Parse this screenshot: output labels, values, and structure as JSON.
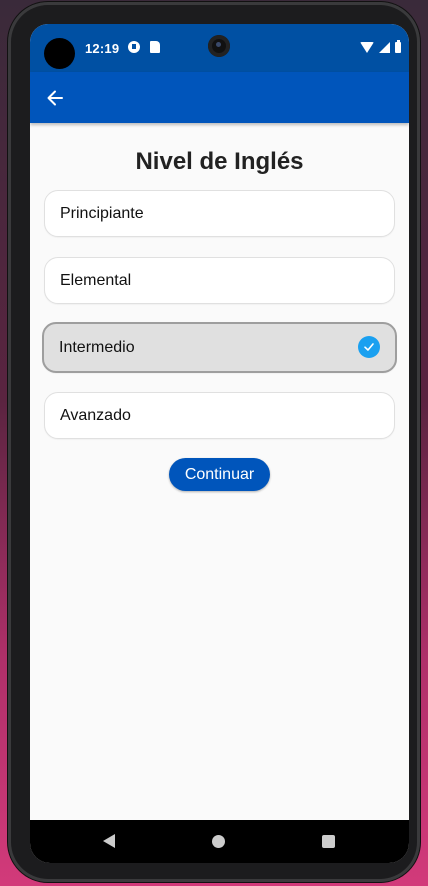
{
  "status_bar": {
    "time": "12:19"
  },
  "app_bar": {
    "back_icon": "arrow-left-icon"
  },
  "page": {
    "title": "Nivel de Inglés"
  },
  "options": [
    {
      "label": "Principiante",
      "selected": false
    },
    {
      "label": "Elemental",
      "selected": false
    },
    {
      "label": "Intermedio",
      "selected": true
    },
    {
      "label": "Avanzado",
      "selected": false
    }
  ],
  "actions": {
    "continue_label": "Continuar"
  },
  "colors": {
    "primary": "#0055bb",
    "status_bar": "#0050a3",
    "check": "#1aa0f0",
    "selected_bg": "#e0e0e0"
  }
}
